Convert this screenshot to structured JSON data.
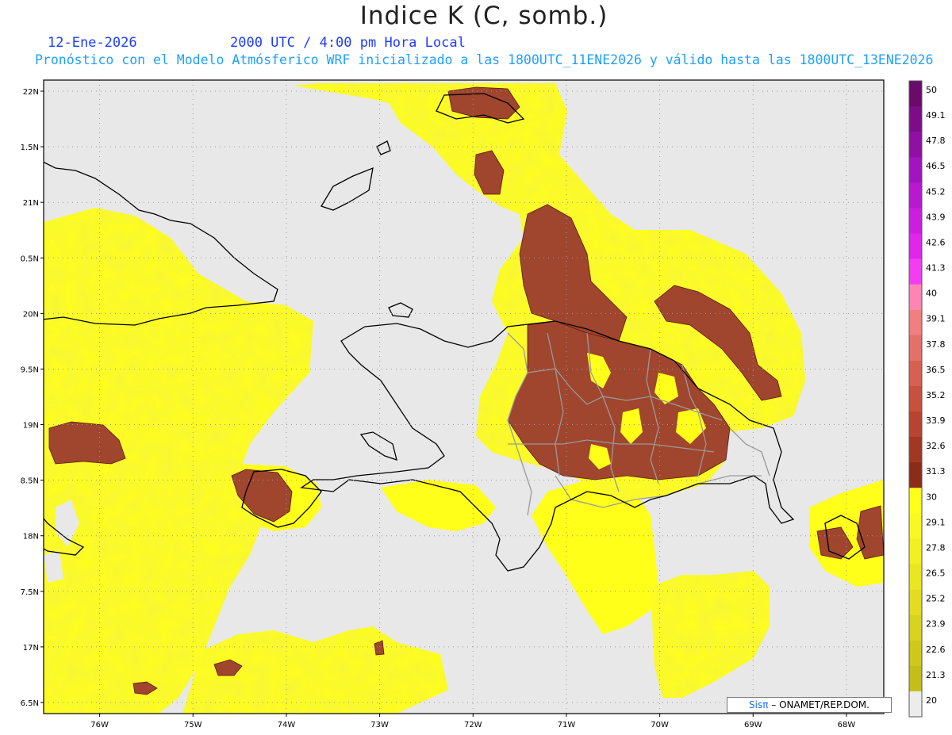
{
  "header": {
    "title": "Indice K (C, somb.)",
    "date": "12-Ene-2026",
    "time": "2000 UTC / 4:00 pm Hora Local",
    "subtitle": "Pronóstico con el Modelo Atmósferico WRF inicializado a las 1800UTC_11ENE2026 y válido hasta las  1800UTC_13ENE2026"
  },
  "map": {
    "lat_labels": [
      "22N",
      "1.5N",
      "21N",
      "0.5N",
      "20N",
      "9.5N",
      "19N",
      "8.5N",
      "18N",
      "7.5N",
      "17N",
      "6.5N"
    ],
    "lon_labels": [
      "76W",
      "75W",
      "74W",
      "73W",
      "72W",
      "71W",
      "70W",
      "69W",
      "68W"
    ],
    "lat_range": [
      16.4,
      22.1
    ],
    "lon_range": [
      -76.6,
      -67.6
    ],
    "colors": {
      "no_data": "#e8e8e8",
      "low_band": "#e6e21e",
      "mid_band": "#ffff1a",
      "high_band": "#a0452e",
      "coast": "#000000",
      "provinces": "#9a9a9a"
    }
  },
  "colorbar": {
    "labels": [
      "50",
      "49.1",
      "47.8",
      "46.5",
      "45.2",
      "43.9",
      "42.6",
      "41.3",
      "40",
      "39.1",
      "37.8",
      "36.5",
      "35.2",
      "33.9",
      "32.6",
      "31.3",
      "30",
      "29.1",
      "27.8",
      "26.5",
      "25.2",
      "23.9",
      "22.6",
      "21.3",
      "20"
    ],
    "colors": [
      "#6a0a6a",
      "#7d0d86",
      "#8f10a3",
      "#a214bf",
      "#b818d2",
      "#cc1ee0",
      "#e026ea",
      "#f23ef0",
      "#ff86b4",
      "#f27f80",
      "#e4706a",
      "#d86052",
      "#c8503e",
      "#b64430",
      "#a03824",
      "#8a2c18",
      "#ffff1a",
      "#f9f822",
      "#f2ef22",
      "#ebe622",
      "#e3dc20",
      "#d9d21e",
      "#cfc81c",
      "#c5be1a",
      "#ececec"
    ]
  },
  "credit": {
    "sis": "Sisπ",
    "org": "– ONAMET/REP.DOM."
  }
}
